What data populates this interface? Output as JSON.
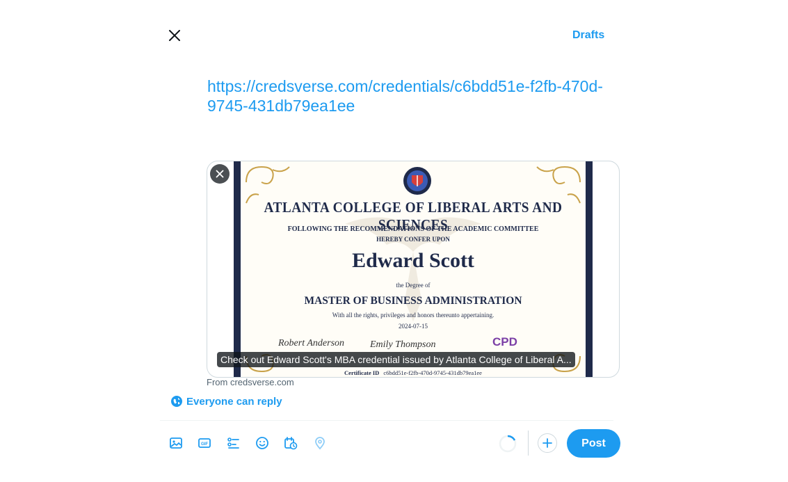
{
  "header": {
    "close_icon": "close-icon",
    "drafts_label": "Drafts"
  },
  "composer": {
    "text": "https://credsverse.com/credentials/c6bdd51e-f2fb-470d-9745-431db79ea1ee"
  },
  "link_card": {
    "remove_icon": "close-icon",
    "certificate": {
      "college": "ATLANTA COLLEGE OF LIBERAL ARTS AND SCIENCES",
      "following": "FOLLOWING THE RECOMMENDATIONS OF THE ACADEMIC COMMITTEE",
      "confer": "HEREBY CONFER UPON",
      "recipient": "Edward Scott",
      "degree_prefix": "the Degree of",
      "degree": "MASTER OF BUSINESS ADMINISTRATION",
      "rights": "With all the rights, privileges and honors thereunto appertaining.",
      "date": "2024-07-15",
      "signature_1": "Robert Anderson",
      "signature_2": "Emily Thompson",
      "badge": "CPD",
      "certificate_id_label": "Certificate ID",
      "certificate_id": "c6bdd51e-f2fb-470d-9745-431db79ea1ee"
    },
    "caption": "Check out Edward Scott's MBA credential issued by Atlanta College of Liberal A...",
    "source": "From credsverse.com"
  },
  "reply_setting": {
    "icon": "globe-icon",
    "label": "Everyone can reply"
  },
  "toolbar": {
    "icons": [
      "image-icon",
      "gif-icon",
      "poll-icon",
      "emoji-icon",
      "schedule-icon",
      "location-icon"
    ],
    "add_icon": "plus-icon",
    "post_label": "Post"
  },
  "colors": {
    "accent": "#1d9bf0",
    "border": "#cfd9de",
    "muted_text": "#536471",
    "certificate_navy": "#1f2a4a",
    "certificate_gold": "#c9a24a"
  }
}
